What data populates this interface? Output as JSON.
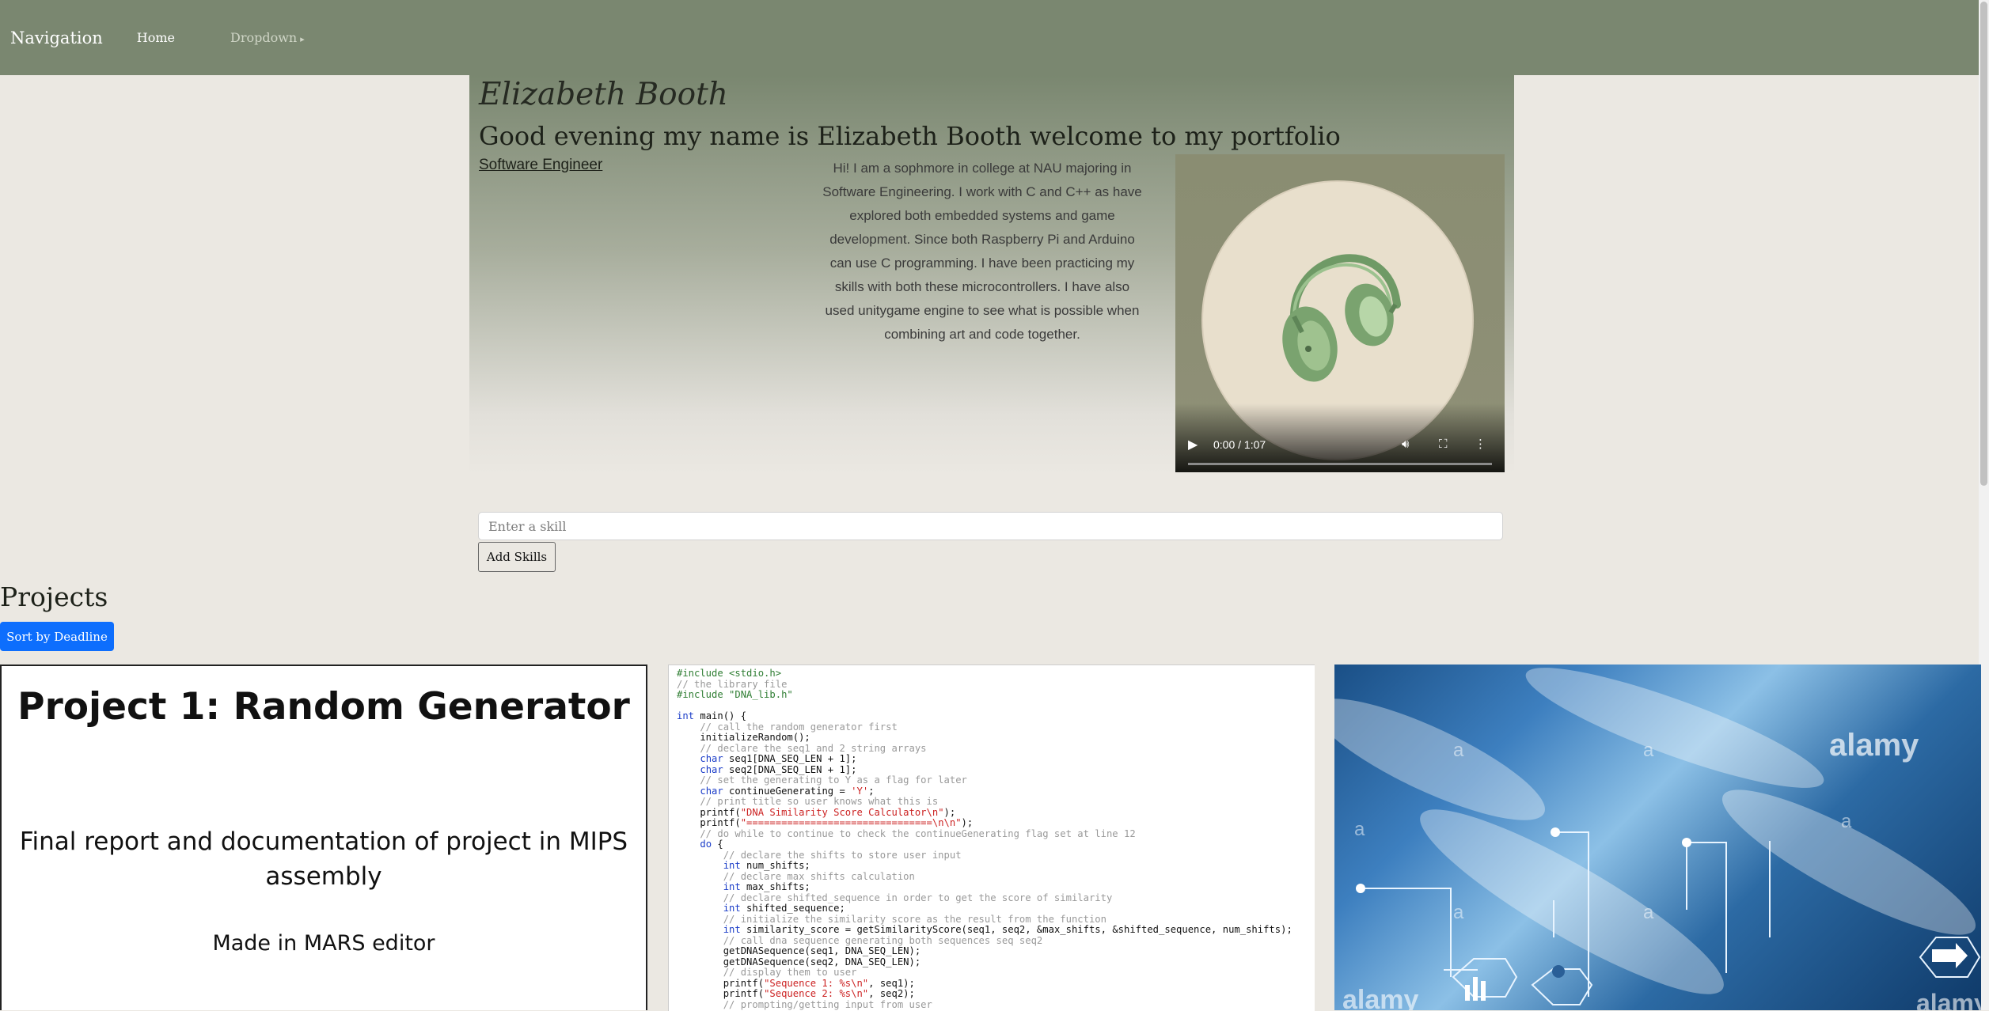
{
  "nav": {
    "brand": "Navigation",
    "home": "Home",
    "dropdown": "Dropdown"
  },
  "hero": {
    "name": "Elizabeth Booth",
    "greeting": "Good evening my name is Elizabeth Booth welcome to my portfolio",
    "role": "Software Engineer",
    "bio": "Hi! I am a sophmore in college at NAU majoring in Software Engineering. I work with C and C++ as have explored both embedded systems and game development. Since both Raspberry Pi and Arduino can use C programming. I have been practicing my skills with both these microcontrollers. I have also used unitygame engine to see what is possible when combining art and code together.",
    "video": {
      "time": "0:00 / 1:07",
      "progress": 0
    }
  },
  "skills": {
    "placeholder": "Enter a skill",
    "button": "Add Skills"
  },
  "projects": {
    "title": "Projects",
    "sort_button": "Sort by Deadline",
    "card1": {
      "title": "Project 1: Random Generator",
      "description": "Final report and documentation of project in MIPS assembly",
      "made_in": "Made in MARS editor"
    },
    "code_lines": [
      "#include <stdio.h>",
      "// the library file",
      "#include \"DNA_lib.h\"",
      "",
      "int main() {",
      "    // call the random generator first",
      "    initializeRandom();",
      "    // declare the seq1 and 2 string arrays",
      "    char seq1[DNA_SEQ_LEN + 1];",
      "    char seq2[DNA_SEQ_LEN + 1];",
      "    // set the generating to Y as a flag for later",
      "    char continueGenerating = 'Y';",
      "    // print title so user knows what this is",
      "    printf(\"DNA Similarity Score Calculator\\n\");",
      "    printf(\"================================\\n\\n\");",
      "    // do while to continue to check the continueGenerating flag set at line 12",
      "    do {",
      "        // declare the shifts to store user input",
      "        int num_shifts;",
      "        // declare max shifts calculation",
      "        int max_shifts;",
      "        // declare shifted_sequence in order to get the score of similarity",
      "        int shifted_sequence;",
      "        // initialize the similarity score as the result from the function",
      "        int similarity_score = getSimilarityScore(seq1, seq2, &max_shifts, &shifted_sequence, num_shifts);",
      "        // call dna sequence generating both sequences seq seq2",
      "        getDNASequence(seq1, DNA_SEQ_LEN);",
      "        getDNASequence(seq2, DNA_SEQ_LEN);",
      "        // display them to user",
      "        printf(\"Sequence 1: %s\\n\", seq1);",
      "        printf(\"Sequence 2: %s\\n\", seq2);",
      "        // prompting/getting input from user"
    ],
    "card3_watermark": "alamy",
    "card3_label": "a"
  }
}
